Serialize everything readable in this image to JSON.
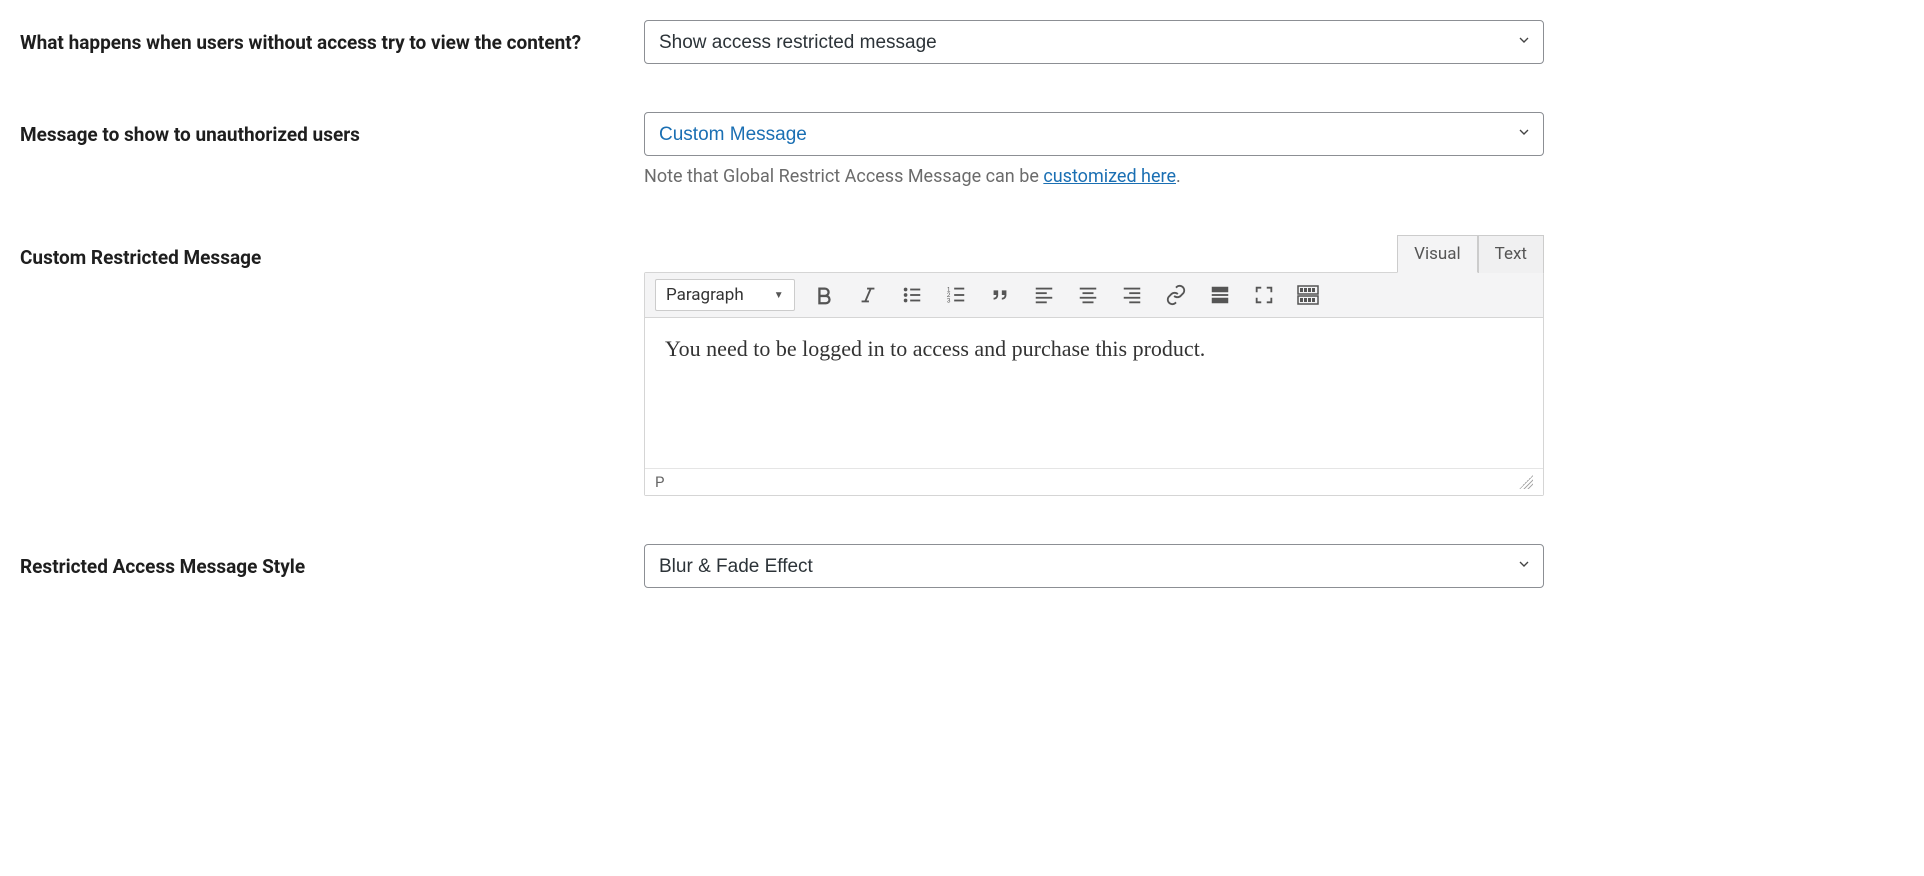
{
  "rows": {
    "no_access": {
      "label": "What happens when users without access try to view the content?",
      "value": "Show access restricted message"
    },
    "unauth_msg": {
      "label": "Message to show to unauthorized users",
      "value": "Custom Message",
      "note_prefix": "Note that Global Restrict Access Message can be ",
      "note_link": "customized here",
      "note_suffix": "."
    },
    "custom_msg": {
      "label": "Custom Restricted Message"
    },
    "style": {
      "label": "Restricted Access Message Style",
      "value": "Blur & Fade Effect"
    }
  },
  "editor": {
    "tabs": {
      "visual": "Visual",
      "text": "Text"
    },
    "format": "Paragraph",
    "content": "You need to be logged in to access and purchase this product.",
    "status": "P"
  }
}
